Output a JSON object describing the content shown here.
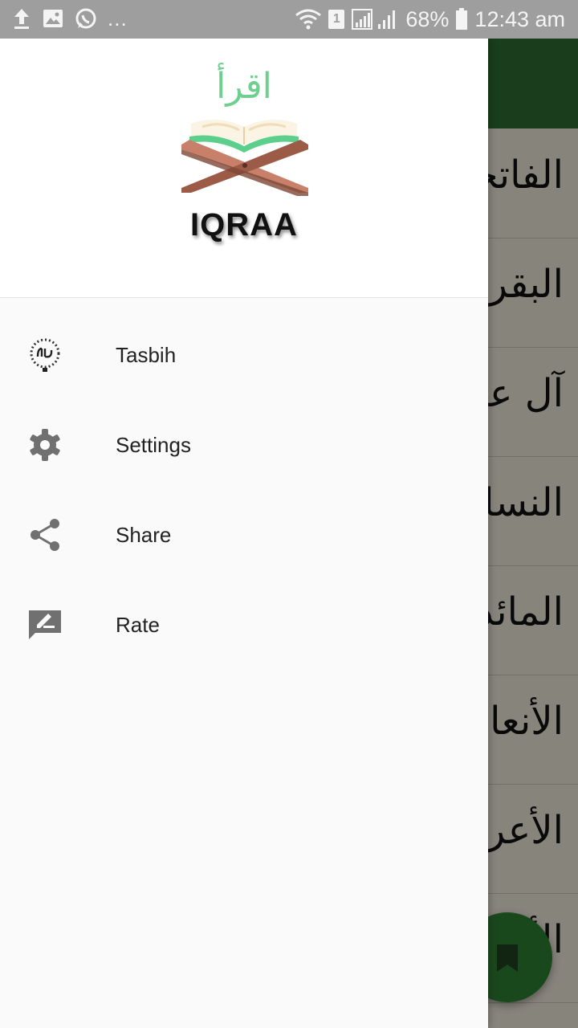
{
  "status_bar": {
    "overflow": "...",
    "sim_slot": "1",
    "battery": "68%",
    "time": "12:43 am",
    "icons": [
      "upload-icon",
      "image-icon",
      "whatsapp-icon",
      "wifi-icon",
      "signal-icon",
      "battery-icon"
    ]
  },
  "drawer": {
    "logo_arabic": "اقرأ",
    "app_name": "IQRAA",
    "menu": [
      {
        "label": "Tasbih",
        "icon": "tasbih-icon"
      },
      {
        "label": "Settings",
        "icon": "gear-icon"
      },
      {
        "label": "Share",
        "icon": "share-icon"
      },
      {
        "label": "Rate",
        "icon": "rate-icon"
      }
    ]
  },
  "background_list": {
    "items": [
      "الفاتحة",
      "البقرة",
      "آل عمران",
      "النساء",
      "المائدة",
      "الأنعام",
      "الأعراف",
      "الأنفال"
    ]
  },
  "fab": {
    "icon": "bookmark-icon"
  },
  "colors": {
    "toolbar": "#2e6b2f",
    "fab": "#2e7d32",
    "logo_green": "#6fcf8e",
    "status_bar": "#9e9e9e"
  }
}
